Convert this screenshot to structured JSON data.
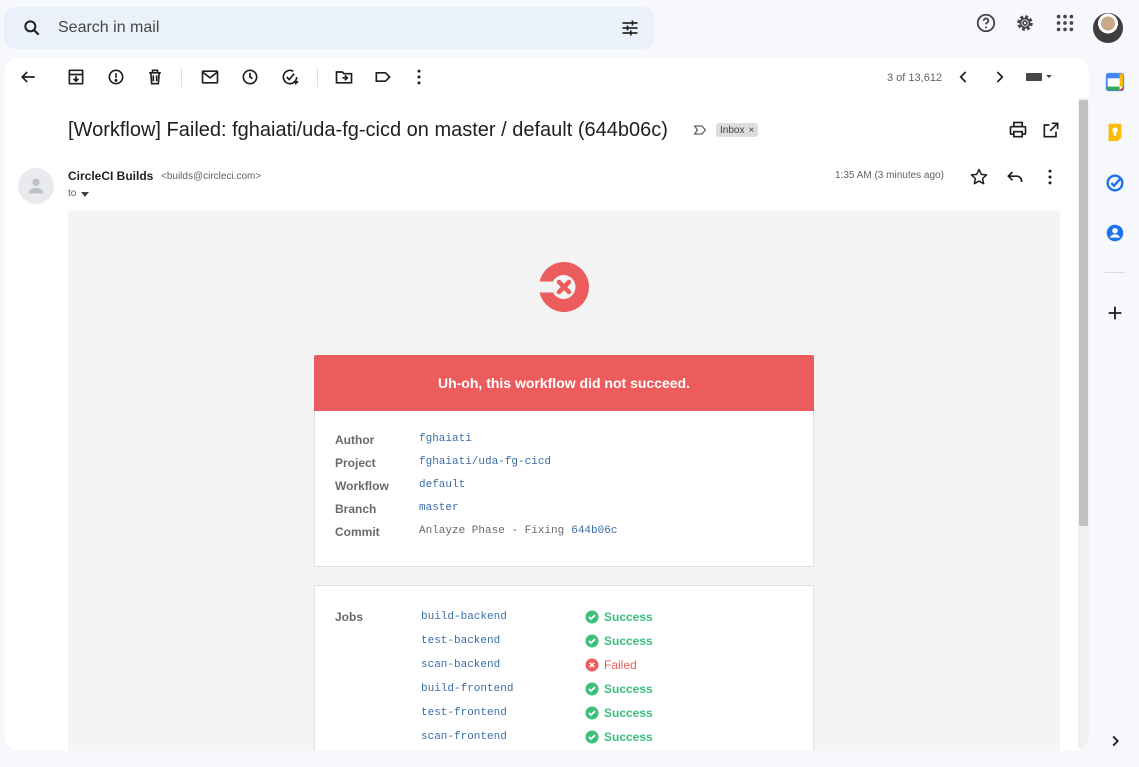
{
  "search": {
    "placeholder": "Search in mail"
  },
  "toolbar": {
    "pager": "3 of 13,612"
  },
  "email": {
    "subject": "[Workflow] Failed: fghaiati/uda-fg-cicd on master / default (644b06c)",
    "label_chip": "Inbox",
    "label_chip_close": "×",
    "sender_name": "CircleCI Builds",
    "sender_email": "<builds@circleci.com>",
    "to": "to",
    "time": "1:35 AM (3 minutes ago)"
  },
  "body": {
    "banner": "Uh-oh, this workflow did not succeed.",
    "details": [
      {
        "label": "Author",
        "value": "fghaiati"
      },
      {
        "label": "Project",
        "value": "fghaiati/uda-fg-cicd"
      },
      {
        "label": "Workflow",
        "value": "default"
      },
      {
        "label": "Branch",
        "value": "master"
      },
      {
        "label": "Commit",
        "value": "Anlayze Phase - Fixing",
        "hash": "644b06c"
      }
    ],
    "jobs_label": "Jobs",
    "jobs": [
      {
        "name": "build-backend",
        "status": "Success"
      },
      {
        "name": "test-backend",
        "status": "Success"
      },
      {
        "name": "scan-backend",
        "status": "Failed"
      },
      {
        "name": "build-frontend",
        "status": "Success"
      },
      {
        "name": "test-frontend",
        "status": "Success"
      },
      {
        "name": "scan-frontend",
        "status": "Success"
      }
    ]
  },
  "colors": {
    "fail": "#ed5c5c",
    "success": "#3cbf7a",
    "link": "#3b6ea5"
  },
  "icons": [
    "search-icon",
    "filter-icon",
    "help-icon",
    "settings-icon",
    "apps-icon",
    "back-icon",
    "archive-icon",
    "report-spam-icon",
    "delete-icon",
    "mark-unread-icon",
    "snooze-icon",
    "add-task-icon",
    "move-to-icon",
    "label-icon",
    "more-icon",
    "prev-icon",
    "next-icon",
    "keyboard-icon",
    "print-icon",
    "open-new-window-icon",
    "star-icon",
    "reply-icon",
    "calendar-icon",
    "keep-icon",
    "tasks-icon",
    "contacts-icon",
    "plus-icon",
    "expand-icon"
  ]
}
